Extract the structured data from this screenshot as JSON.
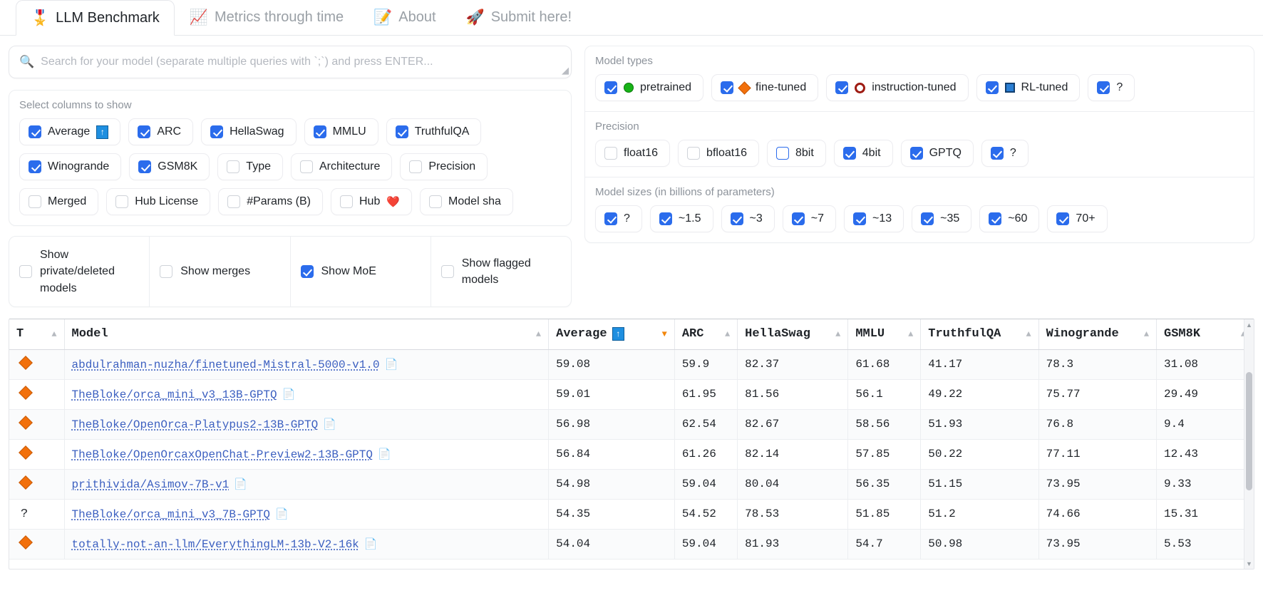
{
  "tabs": [
    {
      "label": "LLM Benchmark",
      "icon": "medal-icon",
      "glyph": "🎖️",
      "active": true
    },
    {
      "label": "Metrics through time",
      "icon": "chart-icon",
      "glyph": "📈",
      "active": false
    },
    {
      "label": "About",
      "icon": "note-icon",
      "glyph": "📝",
      "active": false
    },
    {
      "label": "Submit here!",
      "icon": "rocket-icon",
      "glyph": "🚀",
      "active": false
    }
  ],
  "search": {
    "placeholder": "Search for your model (separate multiple queries with `;`) and press ENTER...",
    "value": "",
    "icon": "search-icon",
    "glyph": "🔍"
  },
  "columns_panel": {
    "title": "Select columns to show",
    "items": [
      {
        "label": "Average",
        "checked": true,
        "badge": "↑"
      },
      {
        "label": "ARC",
        "checked": true
      },
      {
        "label": "HellaSwag",
        "checked": true
      },
      {
        "label": "MMLU",
        "checked": true
      },
      {
        "label": "TruthfulQA",
        "checked": true
      },
      {
        "label": "Winogrande",
        "checked": true
      },
      {
        "label": "GSM8K",
        "checked": true
      },
      {
        "label": "Type",
        "checked": false
      },
      {
        "label": "Architecture",
        "checked": false
      },
      {
        "label": "Precision",
        "checked": false
      },
      {
        "label": "Merged",
        "checked": false
      },
      {
        "label": "Hub License",
        "checked": false
      },
      {
        "label": "#Params (B)",
        "checked": false
      },
      {
        "label": "Hub",
        "checked": false,
        "heart": "❤️"
      },
      {
        "label": "Model sha",
        "checked": false
      }
    ]
  },
  "show_flags": [
    {
      "label": "Show private/deleted models",
      "checked": false
    },
    {
      "label": "Show merges",
      "checked": false
    },
    {
      "label": "Show MoE",
      "checked": true
    },
    {
      "label": "Show flagged models",
      "checked": false
    }
  ],
  "model_types": {
    "title": "Model types",
    "items": [
      {
        "label": "pretrained",
        "checked": true,
        "marker": "circle-green-icon"
      },
      {
        "label": "fine-tuned",
        "checked": true,
        "marker": "diamond-orange-icon"
      },
      {
        "label": "instruction-tuned",
        "checked": true,
        "marker": "ring-red-icon"
      },
      {
        "label": "RL-tuned",
        "checked": true,
        "marker": "square-blue-icon"
      },
      {
        "label": "?",
        "checked": true,
        "marker": "none"
      }
    ]
  },
  "precision": {
    "title": "Precision",
    "items": [
      {
        "label": "float16",
        "checked": false
      },
      {
        "label": "bfloat16",
        "checked": false
      },
      {
        "label": "8bit",
        "checked": false,
        "focused": true
      },
      {
        "label": "4bit",
        "checked": true
      },
      {
        "label": "GPTQ",
        "checked": true
      },
      {
        "label": "?",
        "checked": true
      }
    ]
  },
  "model_sizes": {
    "title": "Model sizes (in billions of parameters)",
    "items": [
      {
        "label": "?",
        "checked": true
      },
      {
        "label": "~1.5",
        "checked": true
      },
      {
        "label": "~3",
        "checked": true
      },
      {
        "label": "~7",
        "checked": true
      },
      {
        "label": "~13",
        "checked": true
      },
      {
        "label": "~35",
        "checked": true
      },
      {
        "label": "~60",
        "checked": true
      },
      {
        "label": "70+",
        "checked": true
      }
    ]
  },
  "table": {
    "headers": [
      {
        "label": "T",
        "sort": "asc",
        "badge": ""
      },
      {
        "label": "Model",
        "sort": "asc",
        "badge": ""
      },
      {
        "label": "Average",
        "sort": "desc",
        "badge": "↑"
      },
      {
        "label": "ARC",
        "sort": "asc",
        "badge": ""
      },
      {
        "label": "HellaSwag",
        "sort": "asc",
        "badge": ""
      },
      {
        "label": "MMLU",
        "sort": "asc",
        "badge": ""
      },
      {
        "label": "TruthfulQA",
        "sort": "asc",
        "badge": ""
      },
      {
        "label": "Winogrande",
        "sort": "asc",
        "badge": ""
      },
      {
        "label": "GSM8K",
        "sort": "asc",
        "badge": ""
      }
    ],
    "rows": [
      {
        "type": "diamond",
        "type_text": "",
        "model": "abdulrahman-nuzha/finetuned-Mistral-5000-v1.0",
        "average": "59.08",
        "arc": "59.9",
        "hellaswag": "82.37",
        "mmlu": "61.68",
        "truthfulqa": "41.17",
        "winogrande": "78.3",
        "gsm8k": "31.08"
      },
      {
        "type": "diamond",
        "type_text": "",
        "model": "TheBloke/orca_mini_v3_13B-GPTQ",
        "average": "59.01",
        "arc": "61.95",
        "hellaswag": "81.56",
        "mmlu": "56.1",
        "truthfulqa": "49.22",
        "winogrande": "75.77",
        "gsm8k": "29.49"
      },
      {
        "type": "diamond",
        "type_text": "",
        "model": "TheBloke/OpenOrca-Platypus2-13B-GPTQ",
        "average": "56.98",
        "arc": "62.54",
        "hellaswag": "82.67",
        "mmlu": "58.56",
        "truthfulqa": "51.93",
        "winogrande": "76.8",
        "gsm8k": "9.4"
      },
      {
        "type": "diamond",
        "type_text": "",
        "model": "TheBloke/OpenOrcaxOpenChat-Preview2-13B-GPTQ",
        "average": "56.84",
        "arc": "61.26",
        "hellaswag": "82.14",
        "mmlu": "57.85",
        "truthfulqa": "50.22",
        "winogrande": "77.11",
        "gsm8k": "12.43"
      },
      {
        "type": "diamond",
        "type_text": "",
        "model": "prithivida/Asimov-7B-v1",
        "average": "54.98",
        "arc": "59.04",
        "hellaswag": "80.04",
        "mmlu": "56.35",
        "truthfulqa": "51.15",
        "winogrande": "73.95",
        "gsm8k": "9.33"
      },
      {
        "type": "question",
        "type_text": "?",
        "model": "TheBloke/orca_mini_v3_7B-GPTQ",
        "average": "54.35",
        "arc": "54.52",
        "hellaswag": "78.53",
        "mmlu": "51.85",
        "truthfulqa": "51.2",
        "winogrande": "74.66",
        "gsm8k": "15.31"
      },
      {
        "type": "diamond",
        "type_text": "",
        "model": "totally-not-an-llm/EverythingLM-13b-V2-16k",
        "average": "54.04",
        "arc": "59.04",
        "hellaswag": "81.93",
        "mmlu": "54.7",
        "truthfulqa": "50.98",
        "winogrande": "73.95",
        "gsm8k": "5.53"
      }
    ],
    "file_icon": "📄"
  },
  "colors": {
    "accent": "#2b6cec",
    "pretrained": "#17b317",
    "fine_tuned": "#f2700b",
    "instruction_tuned": "#9e1b12",
    "rl_tuned": "#2b7fd4",
    "sort_desc": "#f2860b",
    "link": "#3b5fc0"
  }
}
